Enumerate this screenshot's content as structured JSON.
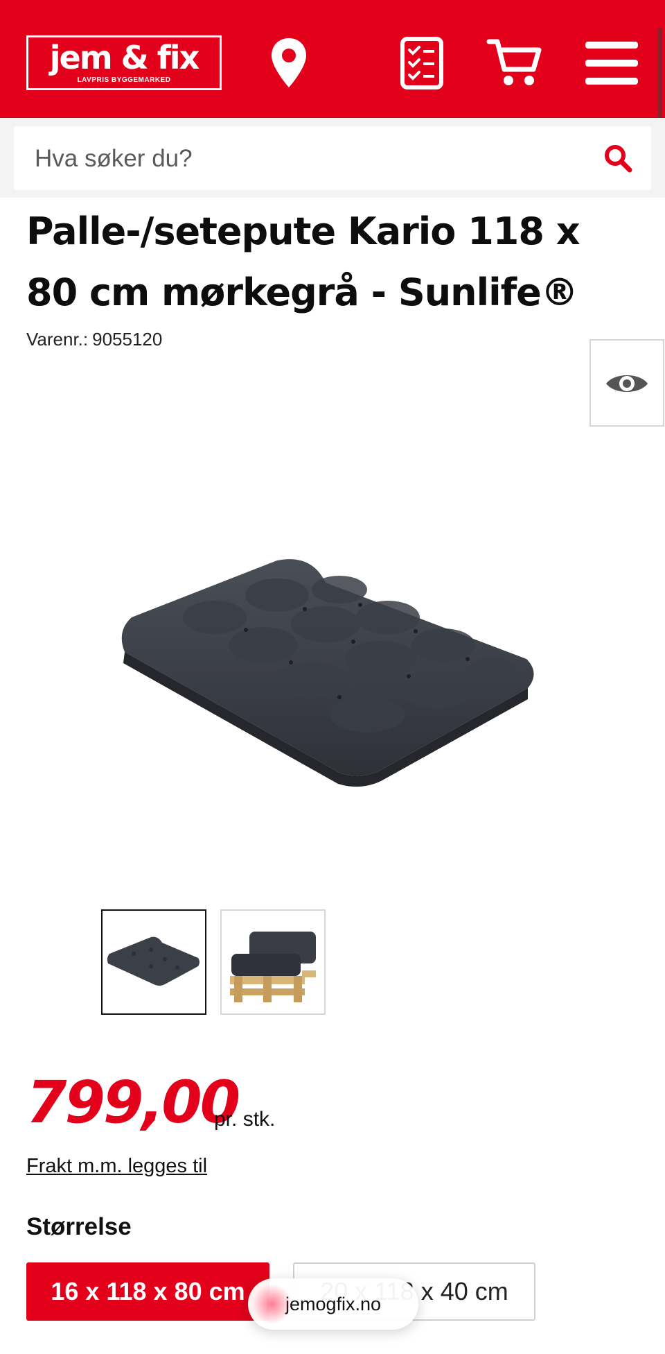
{
  "brand": {
    "logo_text": "jem & fix",
    "logo_tagline": "LAVPRIS BYGGEMARKED",
    "color_primary": "#e2001a"
  },
  "header": {
    "icons": [
      "location-pin-icon",
      "shopping-list-icon",
      "cart-icon",
      "menu-icon"
    ]
  },
  "search": {
    "placeholder": "Hva søker du?",
    "icon": "search-icon"
  },
  "product": {
    "title": "Palle-/setepute Kario 118 x 80 cm mørkegrå - Sunlife®",
    "sku_label": "Varenr.:",
    "sku_value": "9055120",
    "view_icon": "eye-icon",
    "price": "799,00",
    "price_unit": "pr. stk.",
    "freight_link": "Frakt m.m. legges til",
    "size_label": "Størrelse",
    "sizes": [
      {
        "label": "16 x 118 x 80 cm",
        "selected": true
      },
      {
        "label": "20 x 118 x 40 cm",
        "selected": false
      }
    ]
  },
  "browser": {
    "url": "jemogfix.no"
  }
}
